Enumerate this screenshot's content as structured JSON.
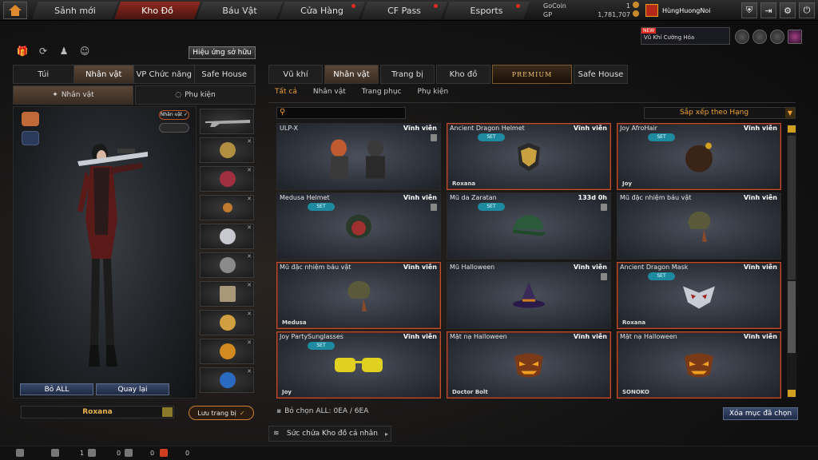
{
  "nav": {
    "tabs": [
      {
        "label": "Sảnh mới",
        "active": false,
        "dot": false
      },
      {
        "label": "Kho Đồ",
        "active": true,
        "dot": false
      },
      {
        "label": "Báu Vật",
        "active": false,
        "dot": false
      },
      {
        "label": "Cửa Hàng",
        "active": false,
        "dot": true
      },
      {
        "label": "CF Pass",
        "active": false,
        "dot": true
      },
      {
        "label": "Esports",
        "active": false,
        "dot": true
      }
    ]
  },
  "currency": {
    "gocoin_label": "GoCoin",
    "gocoin_value": "1",
    "gp_label": "GP",
    "gp_value": "1,781,707"
  },
  "user": {
    "name": "HùngHuongNoi"
  },
  "promo": {
    "badge": "NEW",
    "text": "Vũ Khí Cường Hóa"
  },
  "left": {
    "effect_button": "Hiệu ứng sở hữu",
    "tabs": [
      "Túi",
      "Nhân vật",
      "VP Chức năng",
      "Safe House"
    ],
    "active_tab": 1,
    "subtabs": [
      "Nhân vật",
      "Phụ kiện"
    ],
    "char_tag": "Nhân vật ✓",
    "remove_all": "Bỏ ALL",
    "back": "Quay lại",
    "character_name": "Roxana",
    "save_button": "Lưu trang bị"
  },
  "right": {
    "tabs": [
      "Vũ khí",
      "Nhân vật",
      "Trang bị",
      "Kho đồ",
      "PREMIUM",
      "Safe House"
    ],
    "active_tab": 1,
    "filters": [
      "Tất cả",
      "Nhân vật",
      "Trang phục",
      "Phụ kiện"
    ],
    "active_filter": 0,
    "sort_label": "Sắp xếp theo Hạng",
    "items": [
      {
        "name": "ULP-X",
        "duration": "Vĩnh viễn",
        "set": false,
        "owner": "",
        "selected": false,
        "lock": true,
        "art": "chars"
      },
      {
        "name": "Ancient Dragon Helmet",
        "duration": "Vĩnh viễn",
        "set": true,
        "owner": "Roxana",
        "selected": true,
        "lock": false,
        "art": "helmet"
      },
      {
        "name": "Joy AfroHair",
        "duration": "Vĩnh viễn",
        "set": true,
        "owner": "Joy",
        "selected": true,
        "lock": false,
        "art": "afro"
      },
      {
        "name": "Medusa Helmet",
        "duration": "Vĩnh viễn",
        "set": true,
        "owner": "",
        "selected": false,
        "lock": true,
        "art": "medusa"
      },
      {
        "name": "Mũ da Zaratan",
        "duration": "133d 0h",
        "set": true,
        "owner": "",
        "selected": false,
        "lock": true,
        "art": "cap"
      },
      {
        "name": "Mũ đặc nhiệm báu vật",
        "duration": "Vĩnh viễn",
        "set": false,
        "owner": "",
        "selected": false,
        "lock": false,
        "art": "bandana"
      },
      {
        "name": "Mũ đặc nhiệm báu vật",
        "duration": "Vĩnh viễn",
        "set": false,
        "owner": "Medusa",
        "selected": true,
        "lock": false,
        "art": "bandana"
      },
      {
        "name": "Mũ Halloween",
        "duration": "Vĩnh viễn",
        "set": false,
        "owner": "",
        "selected": false,
        "lock": true,
        "art": "witch"
      },
      {
        "name": "Ancient Dragon Mask",
        "duration": "Vĩnh viễn",
        "set": true,
        "owner": "Roxana",
        "selected": true,
        "lock": false,
        "art": "mask"
      },
      {
        "name": "Joy PartySunglasses",
        "duration": "Vĩnh viễn",
        "set": true,
        "owner": "Joy",
        "selected": true,
        "lock": false,
        "art": "glasses"
      },
      {
        "name": "Mặt nạ Halloween",
        "duration": "Vĩnh viễn",
        "set": false,
        "owner": "Doctor Bolt",
        "selected": true,
        "lock": false,
        "art": "pumpkin"
      },
      {
        "name": "Mặt nạ Halloween",
        "duration": "Vĩnh viễn",
        "set": false,
        "owner": "SONOKO",
        "selected": true,
        "lock": false,
        "art": "pumpkin"
      }
    ],
    "set_label": "SET",
    "deselect_text": "Bỏ chọn ALL: 0EA / 6EA",
    "clear_button": "Xóa mục đã chọn",
    "capacity_label": "Sức chứa Kho đồ cá nhân"
  },
  "bottom": {
    "counts": [
      "1",
      "0",
      "0",
      "0"
    ]
  }
}
